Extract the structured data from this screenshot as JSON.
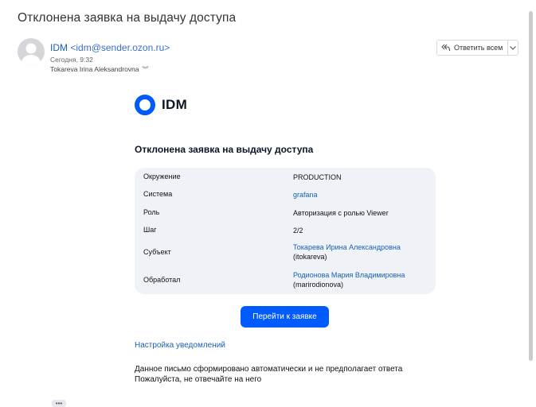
{
  "email": {
    "subject": "Отклонена заявка на выдачу доступа",
    "sender_name": "IDM",
    "sender_address": "<idm@sender.ozon.ru>",
    "date": "Сегодня, 9:32",
    "recipient": "Tokareva Irina Aleksandrovna",
    "reply_all_label": "Ответить всем"
  },
  "body": {
    "logo_text": "IDM",
    "title": "Отклонена заявка на выдачу доступа",
    "rows": [
      {
        "key": "Окружение",
        "value": "PRODUCTION"
      },
      {
        "key": "Система",
        "value": "grafana"
      },
      {
        "key": "Роль",
        "value": "Авторизация с ролью Viewer"
      },
      {
        "key": "Шаг",
        "value": "2/2"
      },
      {
        "key": "Субъект",
        "value": "Токарева Ирина Александровна",
        "value2": "(itokareva)"
      },
      {
        "key": "Обработал",
        "value": "Родионова Мария Владимировна",
        "value2": "(marirodionova)"
      }
    ],
    "cta_label": "Перейти к заявке",
    "settings_link": "Настройка уведомлений",
    "footer_line1": "Данное письмо сформировано автоматически и не предполагает ответа",
    "footer_line2": "Пожалуйста, не отвечайте на него",
    "more_label": "•••"
  },
  "colors": {
    "accent": "#005bff",
    "link": "#1a5fb4",
    "card_bg": "#eff3f8"
  }
}
